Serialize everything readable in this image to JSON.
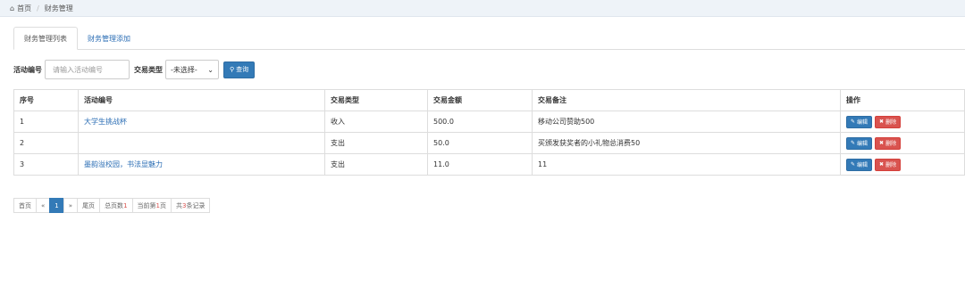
{
  "breadcrumb": {
    "home": "首页",
    "current": "财务管理"
  },
  "tabs": [
    {
      "label": "财务管理列表"
    },
    {
      "label": "财务管理添加"
    }
  ],
  "filter": {
    "activity_label": "活动编号",
    "activity_placeholder": "请输入活动编号",
    "type_label": "交易类型",
    "type_selected": "-未选择-",
    "search_label": "查询"
  },
  "table": {
    "headers": [
      "序号",
      "活动编号",
      "交易类型",
      "交易金额",
      "交易备注",
      "操作"
    ],
    "rows": [
      {
        "no": "1",
        "activity": "大学生挑战杯",
        "type": "收入",
        "amount": "500.0",
        "note": "移动公司赞助500"
      },
      {
        "no": "2",
        "activity": "",
        "type": "支出",
        "amount": "50.0",
        "note": "买颁发获奖者的小礼物总消费50"
      },
      {
        "no": "3",
        "activity": "墨韵溢校园，书法显魅力",
        "type": "支出",
        "amount": "11.0",
        "note": "11"
      }
    ],
    "edit_label": "编辑",
    "delete_label": "删除"
  },
  "pager": {
    "first": "首页",
    "prev": "«",
    "page": "1",
    "next": "»",
    "last": "尾页",
    "total_pages_prefix": "总页数",
    "total_pages": "1",
    "current_prefix": "当前第",
    "current_page": "1",
    "current_suffix": "页",
    "records_prefix": "共",
    "records": "3",
    "records_suffix": "条记录"
  }
}
